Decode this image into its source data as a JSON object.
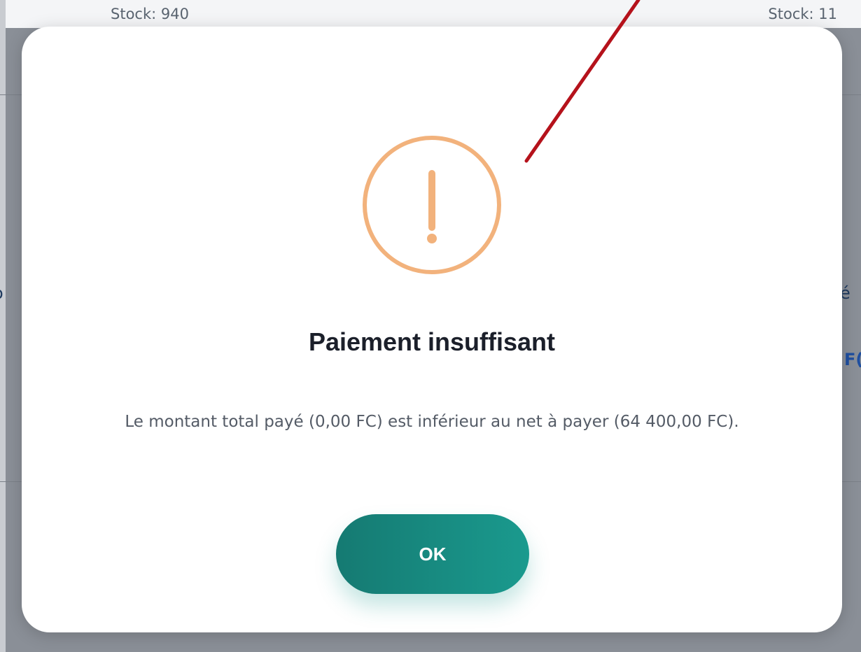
{
  "background": {
    "stock_left": "Stock: 940",
    "stock_right": "Stock: 11",
    "peek_left": "o",
    "peek_right_1": "é",
    "peek_right_2": "F("
  },
  "dialog": {
    "icon": "exclamation-circle-icon",
    "icon_color": "#f2b27c",
    "title": "Paiement insuffisant",
    "message": "Le montant total payé (0,00 FC) est inférieur au net à payer (64 400,00 FC).",
    "ok_label": "OK",
    "button_color": "#178a80"
  },
  "annotation": {
    "arrow_color": "#b5121b"
  }
}
